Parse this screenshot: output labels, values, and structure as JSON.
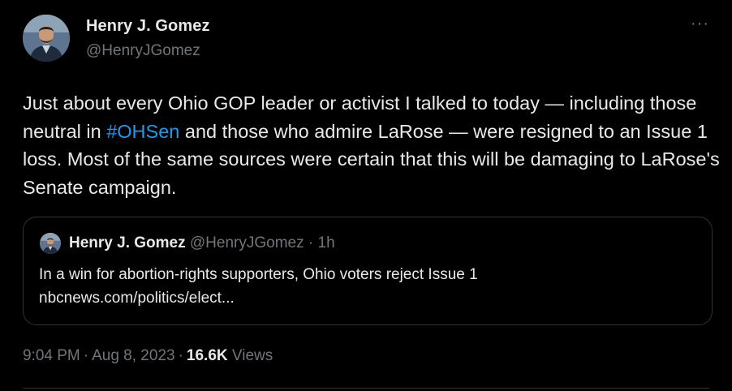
{
  "author": {
    "name": "Henry J. Gomez",
    "handle": "@HenryJGomez"
  },
  "more_icon": "more-horizontal-icon",
  "tweet": {
    "text_before": "Just about every Ohio GOP leader or activist I talked to today — including those neutral in ",
    "hashtag": "#OHSen",
    "text_after": " and those who admire LaRose — were resigned to an Issue 1 loss. Most of the same sources were certain that this will be damaging to LaRose's Senate campaign."
  },
  "quote": {
    "name": "Henry J. Gomez",
    "handle": "@HenryJGomez",
    "separator": "·",
    "time": "1h",
    "text": "In a win for abortion-rights supporters, Ohio voters reject Issue 1",
    "link": "nbcnews.com/politics/elect..."
  },
  "meta": {
    "time": "9:04 PM",
    "separator": "·",
    "date": "Aug 8, 2023",
    "views_count": "16.6K",
    "views_label": "Views"
  },
  "colors": {
    "background": "#000000",
    "text": "#e7e9ea",
    "secondary": "#71767b",
    "link": "#1d9bf0",
    "border": "#2f3336"
  }
}
